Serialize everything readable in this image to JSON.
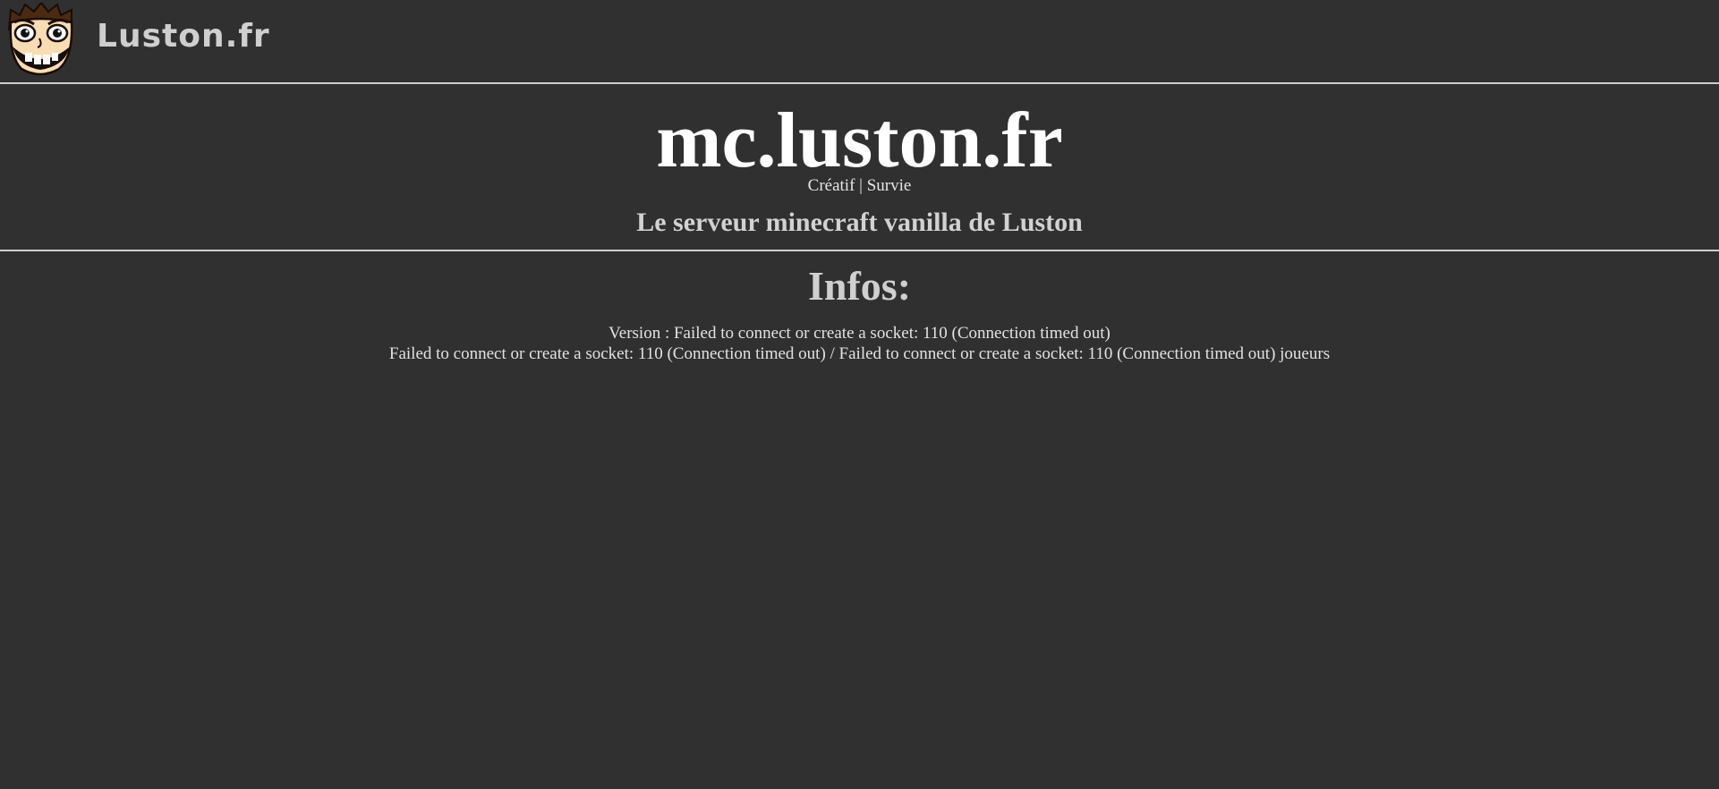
{
  "header": {
    "brand": "Luston.fr",
    "logo_icon": "grinning-face-logo-icon"
  },
  "hero": {
    "title": "mc.luston.fr",
    "modes": "Créatif | Survie",
    "tagline": "Le serveur minecraft vanilla de Luston"
  },
  "infos": {
    "heading": "Infos:",
    "version_line": "Version : Failed to connect or create a socket: 110 (Connection timed out)",
    "players_line": "Failed to connect or create a socket: 110 (Connection timed out) / Failed to connect or create a socket: 110 (Connection timed out) joueurs"
  },
  "colors": {
    "background": "#303030",
    "divider": "#cfcfcf",
    "title": "#ffffff",
    "text": "#d8d8d8"
  }
}
